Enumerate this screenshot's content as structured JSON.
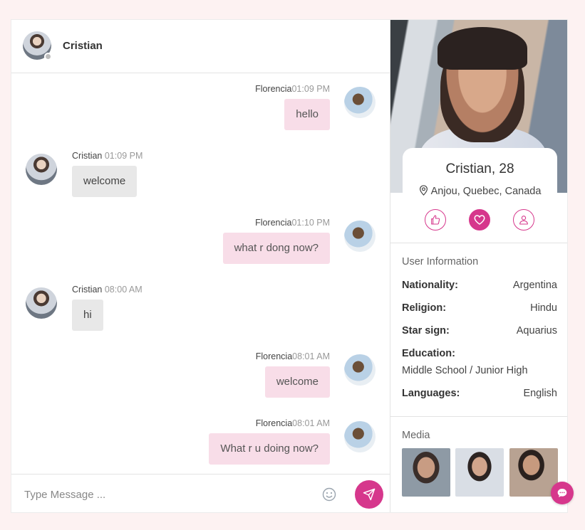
{
  "chat": {
    "contact_name": "Cristian",
    "composer_placeholder": "Type Message ...",
    "messages": [
      {
        "direction": "out",
        "sender": "Florencia",
        "time": "01:09 PM",
        "text": "hello"
      },
      {
        "direction": "in",
        "sender": "Cristian",
        "time": "01:09 PM",
        "text": "welcome"
      },
      {
        "direction": "out",
        "sender": "Florencia",
        "time": "01:10 PM",
        "text": "what r dong now?"
      },
      {
        "direction": "in",
        "sender": "Cristian",
        "time": "08:00 AM",
        "text": "hi"
      },
      {
        "direction": "out",
        "sender": "Florencia",
        "time": "08:01 AM",
        "text": "welcome"
      },
      {
        "direction": "out",
        "sender": "Florencia",
        "time": "08:01 AM",
        "text": "What r u doing now?"
      }
    ]
  },
  "profile": {
    "name_age": "Cristian, 28",
    "location": "Anjou, Quebec, Canada",
    "actions": [
      "thumbs-up-icon",
      "heart-icon",
      "user-icon"
    ],
    "user_info_title": "User Information",
    "info": [
      {
        "label": "Nationality:",
        "value": "Argentina"
      },
      {
        "label": "Religion:",
        "value": "Hindu"
      },
      {
        "label": "Star sign:",
        "value": "Aquarius"
      },
      {
        "label": "Education:",
        "value": "Middle School / Junior High"
      },
      {
        "label": "Languages:",
        "value": "English"
      }
    ],
    "media_title": "Media"
  },
  "colors": {
    "accent": "#d6378c",
    "outgoing_bubble": "#f8dde8",
    "incoming_bubble": "#e8e8e8"
  }
}
